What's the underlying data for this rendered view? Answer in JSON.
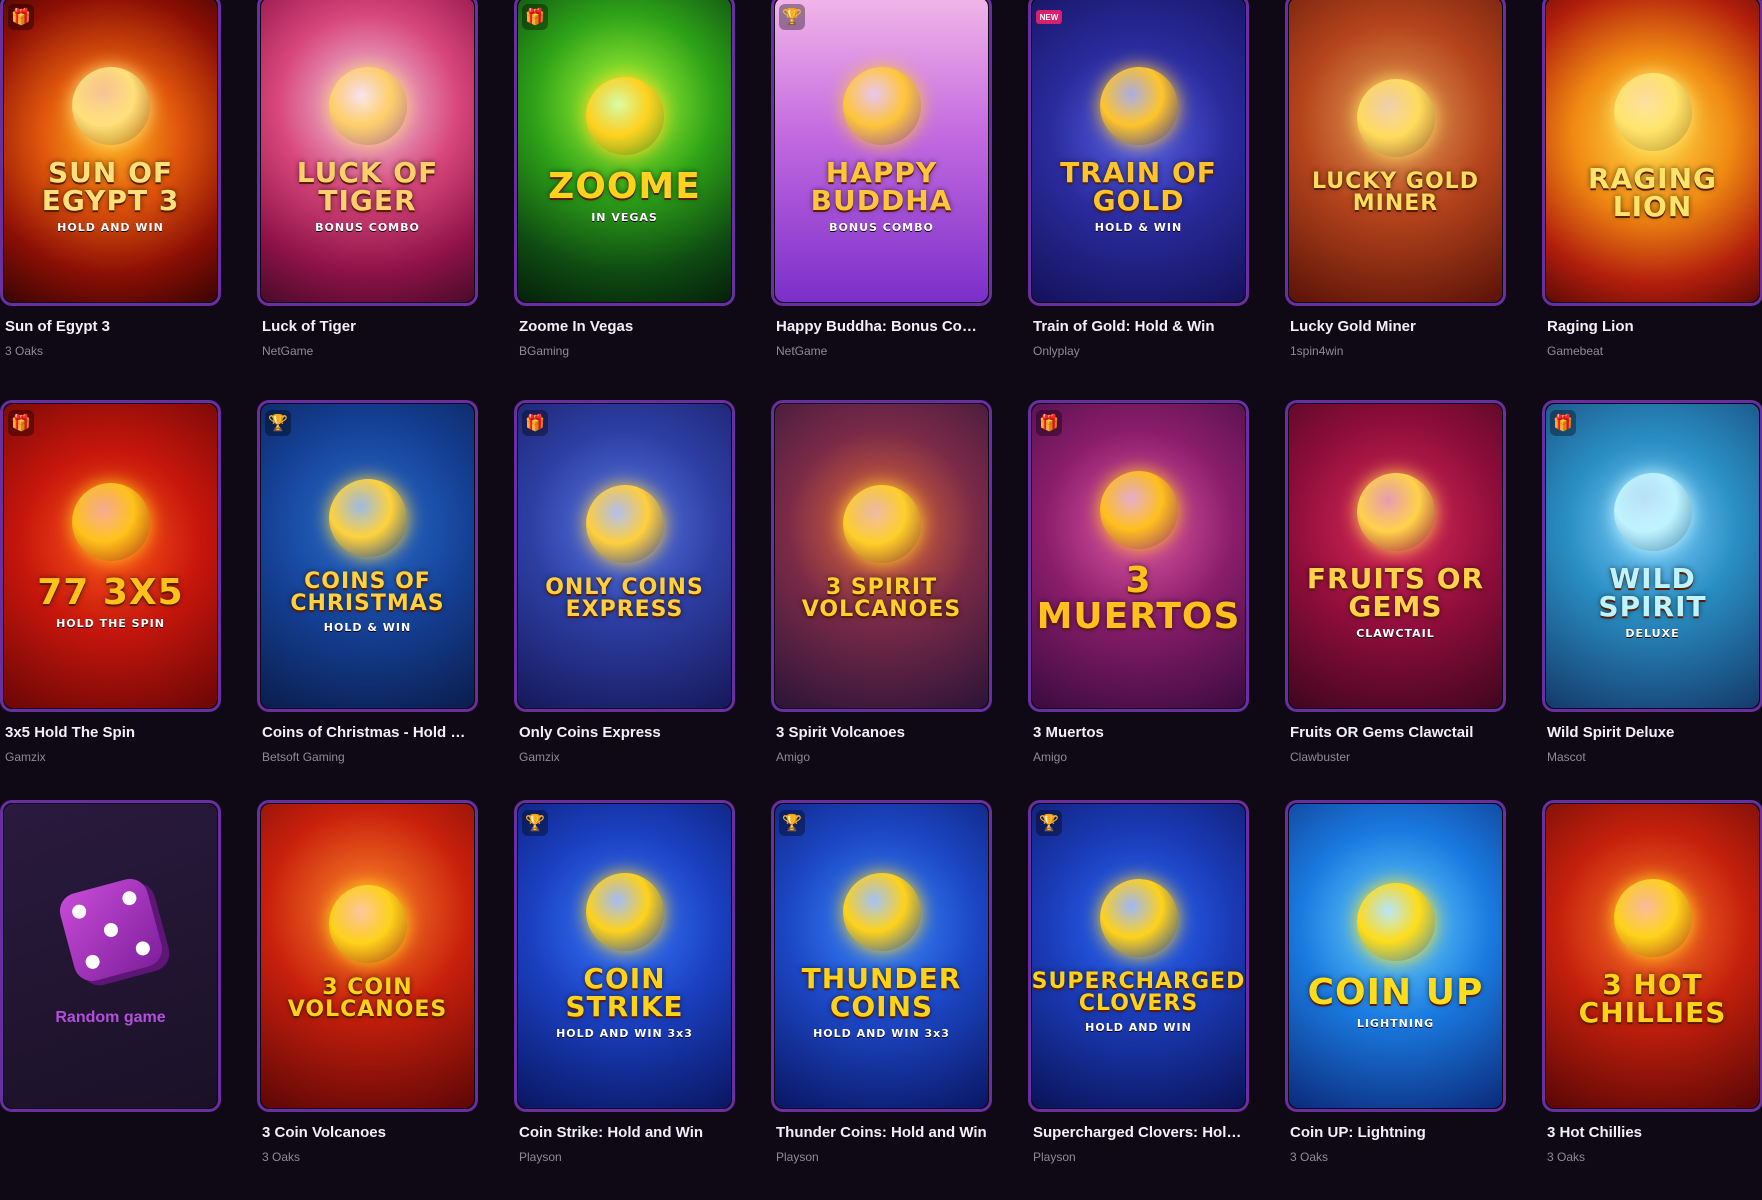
{
  "random": {
    "label": "Random game",
    "icon": "dice-icon"
  },
  "games": [
    {
      "name": "Sun of Egypt 3",
      "provider": "3 Oaks",
      "art": "SUN OF EGYPT 3",
      "sub": "HOLD AND WIN",
      "badge": "gift-icon",
      "bg": "radial-gradient(circle at 50% 45%,#ffb21c 0%,#e0560c 35%,#8c0f05 70%,#3a0402 100%)",
      "color": "#ffe07a"
    },
    {
      "name": "Luck of Tiger",
      "provider": "NetGame",
      "art": "LUCK OF TIGER",
      "sub": "BONUS COMBO",
      "badge": "",
      "bg": "radial-gradient(circle at 50% 35%,#f2d4e8 0%,#d8477b 40%,#8d1247 75%,#4a0a2a 100%)",
      "color": "#ffcf6b"
    },
    {
      "name": "Zoome In Vegas",
      "provider": "BGaming",
      "art": "ZOOME",
      "sub": "IN VEGAS",
      "badge": "gift-icon",
      "bg": "radial-gradient(circle at 50% 35%,#b5ff3a 0%,#2ea318 40%,#0e4a12 75%,#05200a 100%)",
      "color": "#ffd21f"
    },
    {
      "name": "Happy Buddha: Bonus Combo",
      "provider": "NetGame",
      "art": "HAPPY BUDDHA",
      "sub": "BONUS COMBO",
      "badge": "trophy-icon",
      "bg": "linear-gradient(180deg,#f1b6e8 0%,#c36ae0 45%,#7b2fc9 100%)",
      "color": "#ffc53a"
    },
    {
      "name": "Train of Gold: Hold & Win",
      "provider": "Onlyplay",
      "art": "TRAIN OF GOLD",
      "sub": "HOLD & WIN",
      "badge": "new",
      "bg": "radial-gradient(circle at 50% 45%,#5863e8 0%,#2a2a9c 45%,#14125a 100%)",
      "color": "#ffc42a"
    },
    {
      "name": "Lucky Gold Miner",
      "provider": "1spin4win",
      "art": "LUCKY GOLD MINER",
      "sub": "",
      "badge": "",
      "bg": "radial-gradient(circle at 50% 40%,#e7a35a 0%,#b5441c 45%,#5a1208 100%)",
      "color": "#ffdc5c"
    },
    {
      "name": "Raging Lion",
      "provider": "Gamebeat",
      "art": "RAGING LION",
      "sub": "",
      "badge": "",
      "bg": "radial-gradient(circle at 50% 45%,#ffdb4a 0%,#f08a12 40%,#b21e0c 75%,#5e0a06 100%)",
      "color": "#ffe46b"
    },
    {
      "name": "3x5 Hold The Spin",
      "provider": "Gamzix",
      "art": "77 3X5",
      "sub": "HOLD THE SPIN",
      "badge": "gift-icon",
      "bg": "radial-gradient(circle at 50% 45%,#ff5a1a 0%,#c7160c 45%,#6a0606 100%)",
      "color": "#ffc21a"
    },
    {
      "name": "Coins of Christmas - Hold & Win",
      "provider": "Betsoft Gaming",
      "art": "COINS OF CHRISTMAS",
      "sub": "HOLD & WIN",
      "badge": "trophy-icon",
      "bg": "radial-gradient(circle at 50% 40%,#2a6fd0 0%,#143f93 50%,#0b1d4d 100%)",
      "color": "#ffd23c"
    },
    {
      "name": "Only Coins Express",
      "provider": "Gamzix",
      "art": "ONLY COINS EXPRESS",
      "sub": "",
      "badge": "gift-icon",
      "bg": "radial-gradient(circle at 50% 40%,#5a7ae8 0%,#2d3ea3 45%,#17185a 100%)",
      "color": "#ffcf3c"
    },
    {
      "name": "3 Spirit Volcanoes",
      "provider": "Amigo",
      "art": "3 SPIRIT VOLCANOES",
      "sub": "",
      "badge": "",
      "bg": "radial-gradient(circle at 50% 40%,#e96f3a 0%,#7a2a47 45%,#2b1438 100%)",
      "color": "#ffcf2a"
    },
    {
      "name": "3 Muertos",
      "provider": "Amigo",
      "art": "3 MUERTOS",
      "sub": "",
      "badge": "gift-icon",
      "bg": "radial-gradient(circle at 50% 40%,#e25aa5 0%,#8a1d6b 45%,#3a0b3f 100%)",
      "color": "#ffbf1c"
    },
    {
      "name": "Fruits OR Gems Clawctail",
      "provider": "Clawbuster",
      "art": "FRUITS OR GEMS",
      "sub": "CLAWCTAIL",
      "badge": "",
      "bg": "radial-gradient(circle at 50% 40%,#e02a5a 0%,#8d0d3a 50%,#40061e 100%)",
      "color": "#ffd24a"
    },
    {
      "name": "Wild Spirit Deluxe",
      "provider": "Mascot",
      "art": "WILD SPIRIT",
      "sub": "DELUXE",
      "badge": "gift-icon",
      "bg": "radial-gradient(circle at 50% 40%,#7fd1ff 0%,#2a8fc4 40%,#143a6a 100%)",
      "color": "#bff3ff"
    },
    {
      "name": "3 Coin Volcanoes",
      "provider": "3 Oaks",
      "art": "3 COIN VOLCANOES",
      "sub": "",
      "badge": "",
      "bg": "radial-gradient(circle at 50% 35%,#ff8a2a 0%,#c8200c 45%,#5e0606 100%)",
      "color": "#ffd21a"
    },
    {
      "name": "Coin Strike: Hold and Win",
      "provider": "Playson",
      "art": "COIN STRIKE",
      "sub": "HOLD AND WIN 3x3",
      "badge": "trophy-icon",
      "bg": "radial-gradient(circle at 50% 40%,#3a7bff 0%,#1a3fbf 45%,#0a1661 100%)",
      "color": "#ffd21a"
    },
    {
      "name": "Thunder Coins: Hold and Win",
      "provider": "Playson",
      "art": "THUNDER COINS",
      "sub": "HOLD AND WIN 3x3",
      "badge": "trophy-icon",
      "bg": "radial-gradient(circle at 50% 40%,#3a8bff 0%,#1c46c4 45%,#0a1663 100%)",
      "color": "#ffd21a"
    },
    {
      "name": "Supercharged Clovers: Hold and Win",
      "provider": "Playson",
      "art": "SUPERCHARGED CLOVERS",
      "sub": "HOLD AND WIN",
      "badge": "trophy-icon",
      "bg": "radial-gradient(circle at 50% 40%,#2b6bff 0%,#1a3ab5 45%,#0b1358 100%)",
      "color": "#ffd21a"
    },
    {
      "name": "Coin UP: Lightning",
      "provider": "3 Oaks",
      "art": "COIN UP",
      "sub": "LIGHTNING",
      "badge": "",
      "bg": "radial-gradient(circle at 50% 40%,#6fd8ff 0%,#1a7ae0 45%,#0b2a7a 100%)",
      "color": "#ffdd1a"
    },
    {
      "name": "3 Hot Chillies",
      "provider": "3 Oaks",
      "art": "3 HOT CHILLIES",
      "sub": "",
      "badge": "",
      "bg": "radial-gradient(circle at 50% 40%,#ff7a2a 0%,#c4200c 45%,#5a0606 100%)",
      "color": "#ffd21a"
    }
  ]
}
